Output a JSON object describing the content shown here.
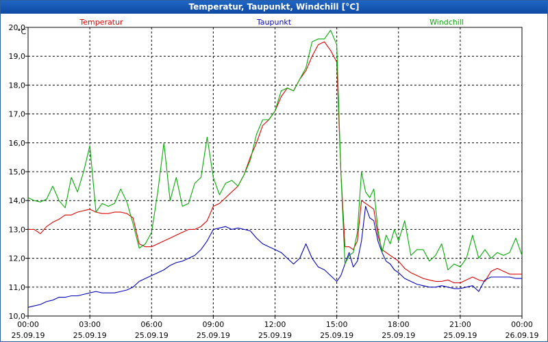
{
  "window": {
    "title": "Temperatur, Taupunkt, Windchill [°C]"
  },
  "chart_data": {
    "type": "line",
    "title": "Temperatur, Taupunkt, Windchill [°C]",
    "ylabel": "°C",
    "ylim": [
      10,
      20
    ],
    "xlim": [
      0,
      24
    ],
    "grid": true,
    "y_ticks": [
      "10,0",
      "11,0",
      "12,0",
      "13,0",
      "14,0",
      "15,0",
      "16,0",
      "17,0",
      "18,0",
      "19,0",
      "20,0"
    ],
    "x_ticks": [
      {
        "time": "00:00",
        "date": "25.09.19"
      },
      {
        "time": "03:00",
        "date": "25.09.19"
      },
      {
        "time": "06:00",
        "date": "25.09.19"
      },
      {
        "time": "09:00",
        "date": "25.09.19"
      },
      {
        "time": "12:00",
        "date": "25.09.19"
      },
      {
        "time": "15:00",
        "date": "25.09.19"
      },
      {
        "time": "18:00",
        "date": "25.09.19"
      },
      {
        "time": "21:00",
        "date": "25.09.19"
      },
      {
        "time": "00:00",
        "date": "26.09.19"
      }
    ],
    "series": [
      {
        "name": "Temperatur",
        "color": "#dd0000",
        "x": [
          0,
          0.3,
          0.6,
          0.9,
          1.2,
          1.5,
          1.8,
          2.1,
          2.4,
          2.7,
          3.0,
          3.3,
          3.6,
          3.9,
          4.2,
          4.5,
          4.8,
          5.1,
          5.4,
          5.7,
          6.0,
          6.3,
          6.6,
          6.9,
          7.2,
          7.5,
          7.8,
          8.1,
          8.4,
          8.7,
          9.0,
          9.3,
          9.6,
          9.9,
          10.2,
          10.5,
          10.8,
          11.1,
          11.4,
          11.7,
          12.0,
          12.3,
          12.6,
          12.9,
          13.2,
          13.5,
          13.8,
          14.1,
          14.4,
          14.7,
          15.0,
          15.2,
          15.4,
          15.6,
          15.8,
          16.0,
          16.2,
          16.4,
          16.6,
          16.8,
          17.0,
          17.2,
          17.4,
          17.6,
          17.8,
          18.0,
          18.3,
          18.6,
          18.9,
          19.2,
          19.5,
          19.8,
          20.1,
          20.4,
          20.7,
          21.0,
          21.3,
          21.6,
          21.9,
          22.2,
          22.5,
          22.8,
          23.1,
          23.4,
          23.7,
          24.0
        ],
        "y": [
          13.0,
          13.0,
          12.85,
          13.1,
          13.25,
          13.35,
          13.5,
          13.5,
          13.6,
          13.65,
          13.7,
          13.6,
          13.55,
          13.55,
          13.6,
          13.6,
          13.55,
          13.4,
          12.5,
          12.4,
          12.4,
          12.5,
          12.6,
          12.7,
          12.8,
          12.9,
          13.0,
          13.0,
          13.1,
          13.3,
          13.8,
          13.9,
          14.1,
          14.3,
          14.5,
          14.9,
          15.5,
          16.0,
          16.6,
          16.8,
          17.1,
          17.6,
          17.9,
          17.8,
          18.2,
          18.5,
          19.0,
          19.4,
          19.5,
          19.2,
          18.8,
          15.0,
          12.4,
          12.4,
          12.3,
          12.6,
          14.0,
          13.9,
          13.8,
          13.7,
          12.8,
          12.3,
          12.2,
          12.1,
          12.0,
          11.9,
          11.65,
          11.5,
          11.4,
          11.3,
          11.25,
          11.2,
          11.2,
          11.25,
          11.15,
          11.15,
          11.25,
          11.35,
          11.25,
          11.2,
          11.55,
          11.65,
          11.55,
          11.45,
          11.45,
          11.45
        ]
      },
      {
        "name": "Taupunkt",
        "color": "#0000bb",
        "x": [
          0,
          0.3,
          0.6,
          0.9,
          1.2,
          1.5,
          1.8,
          2.1,
          2.4,
          2.7,
          3.0,
          3.3,
          3.6,
          3.9,
          4.2,
          4.5,
          4.8,
          5.1,
          5.4,
          5.7,
          6.0,
          6.3,
          6.6,
          6.9,
          7.2,
          7.5,
          7.8,
          8.1,
          8.4,
          8.7,
          9.0,
          9.3,
          9.6,
          9.9,
          10.2,
          10.5,
          10.8,
          11.1,
          11.4,
          11.7,
          12.0,
          12.3,
          12.6,
          12.9,
          13.2,
          13.5,
          13.8,
          14.1,
          14.4,
          14.7,
          15.0,
          15.2,
          15.4,
          15.6,
          15.8,
          16.0,
          16.2,
          16.4,
          16.6,
          16.8,
          17.0,
          17.2,
          17.4,
          17.6,
          17.8,
          18.0,
          18.3,
          18.6,
          18.9,
          19.2,
          19.5,
          19.8,
          20.1,
          20.4,
          20.7,
          21.0,
          21.3,
          21.6,
          21.9,
          22.2,
          22.5,
          22.8,
          23.1,
          23.4,
          23.7,
          24.0
        ],
        "y": [
          10.3,
          10.35,
          10.4,
          10.5,
          10.55,
          10.65,
          10.65,
          10.7,
          10.7,
          10.75,
          10.8,
          10.85,
          10.8,
          10.8,
          10.8,
          10.85,
          10.9,
          11.0,
          11.2,
          11.3,
          11.4,
          11.5,
          11.6,
          11.75,
          11.85,
          11.9,
          12.0,
          12.1,
          12.3,
          12.6,
          13.0,
          13.05,
          13.1,
          13.0,
          13.05,
          13.0,
          12.95,
          12.7,
          12.5,
          12.4,
          12.3,
          12.2,
          12.0,
          11.8,
          12.0,
          12.5,
          12.0,
          11.7,
          11.6,
          11.4,
          11.2,
          11.4,
          11.8,
          12.2,
          11.7,
          11.9,
          12.6,
          13.8,
          13.4,
          13.3,
          12.6,
          12.2,
          11.9,
          11.8,
          11.6,
          11.5,
          11.3,
          11.2,
          11.1,
          11.05,
          11.0,
          11.0,
          11.05,
          11.0,
          10.95,
          10.95,
          11.0,
          11.05,
          10.85,
          11.25,
          11.35,
          11.35,
          11.35,
          11.35,
          11.3,
          11.3
        ]
      },
      {
        "name": "Windchill",
        "color": "#00aa00",
        "x": [
          0,
          0.3,
          0.6,
          0.9,
          1.2,
          1.5,
          1.8,
          2.1,
          2.4,
          2.7,
          3.0,
          3.3,
          3.6,
          3.9,
          4.2,
          4.5,
          4.8,
          5.1,
          5.4,
          5.7,
          6.0,
          6.3,
          6.6,
          6.9,
          7.2,
          7.5,
          7.8,
          8.1,
          8.4,
          8.7,
          9.0,
          9.3,
          9.6,
          9.9,
          10.2,
          10.5,
          10.8,
          11.1,
          11.4,
          11.7,
          12.0,
          12.3,
          12.6,
          12.9,
          13.2,
          13.5,
          13.8,
          14.1,
          14.4,
          14.7,
          15.0,
          15.2,
          15.4,
          15.6,
          15.8,
          16.0,
          16.2,
          16.4,
          16.6,
          16.8,
          17.0,
          17.2,
          17.4,
          17.6,
          17.8,
          18.0,
          18.3,
          18.6,
          18.9,
          19.2,
          19.5,
          19.8,
          20.1,
          20.4,
          20.7,
          21.0,
          21.3,
          21.6,
          21.9,
          22.2,
          22.5,
          22.8,
          23.1,
          23.4,
          23.7,
          24.0
        ],
        "y": [
          14.1,
          14.0,
          13.95,
          14.05,
          14.5,
          14.0,
          13.75,
          14.8,
          14.3,
          15.0,
          15.9,
          13.6,
          13.9,
          13.8,
          13.9,
          14.4,
          13.95,
          13.2,
          12.35,
          12.5,
          12.9,
          14.3,
          16.0,
          14.0,
          14.8,
          13.8,
          13.9,
          14.6,
          14.8,
          16.2,
          14.8,
          14.2,
          14.6,
          14.7,
          14.5,
          14.9,
          15.4,
          16.3,
          16.8,
          16.8,
          17.1,
          17.8,
          17.9,
          17.8,
          18.2,
          18.6,
          19.5,
          19.6,
          19.6,
          19.9,
          19.4,
          15.0,
          11.8,
          12.1,
          12.2,
          12.9,
          15.0,
          14.3,
          14.1,
          14.4,
          13.0,
          12.2,
          12.8,
          12.5,
          13.0,
          12.6,
          13.3,
          12.1,
          12.3,
          12.3,
          11.9,
          12.1,
          12.5,
          11.6,
          11.8,
          11.7,
          12.0,
          12.8,
          12.0,
          12.3,
          12.0,
          12.2,
          12.1,
          12.2,
          12.7,
          12.1
        ]
      }
    ]
  }
}
